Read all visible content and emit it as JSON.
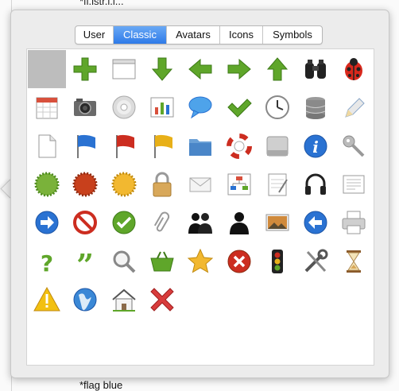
{
  "document": {
    "top_text": "*fl.lstr.l.l...",
    "bottom_text": "*flag blue"
  },
  "tabs": [
    {
      "label": "User",
      "selected": false
    },
    {
      "label": "Classic",
      "selected": true
    },
    {
      "label": "Avatars",
      "selected": false
    },
    {
      "label": "Icons",
      "selected": false
    },
    {
      "label": "Symbols",
      "selected": false
    }
  ],
  "colors": {
    "tab_selected": "#2e7ae8",
    "green": "#5fa62a",
    "blue": "#2a72d2",
    "red": "#cc2d20",
    "yellow": "#e8b018"
  },
  "icons": [
    [
      "blank-selected",
      "plus-icon",
      "window-icon",
      "arrow-down-icon",
      "arrow-left-icon",
      "arrow-right-icon",
      "arrow-up-icon",
      "binoculars-icon",
      "ladybug-icon"
    ],
    [
      "calendar-icon",
      "camera-icon",
      "cd-icon",
      "chart-icon",
      "speech-bubble-icon",
      "checkmark-icon",
      "clock-icon",
      "database-icon",
      "pencil-icon"
    ],
    [
      "document-icon",
      "flag-blue-icon",
      "flag-red-icon",
      "flag-yellow-icon",
      "folder-icon",
      "lifebuoy-icon",
      "hard-drive-icon",
      "info-icon",
      "key-icon"
    ],
    [
      "seal-green-icon",
      "seal-red-icon",
      "seal-yellow-icon",
      "padlock-icon",
      "envelope-icon",
      "org-chart-icon",
      "notepad-icon",
      "headphones-icon",
      "fax-icon"
    ],
    [
      "arrow-circle-right-icon",
      "no-entry-icon",
      "check-circle-icon",
      "paperclip-icon",
      "users-icon",
      "user-icon",
      "picture-icon",
      "arrow-circle-left-icon",
      "printer-icon"
    ],
    [
      "question-mark-icon",
      "quote-icon",
      "magnifier-icon",
      "shopping-basket-icon",
      "star-icon",
      "cancel-circle-icon",
      "traffic-light-icon",
      "tools-icon",
      "hourglass-icon"
    ],
    [
      "warning-icon",
      "globe-icon",
      "house-icon",
      "delete-x-icon"
    ]
  ]
}
